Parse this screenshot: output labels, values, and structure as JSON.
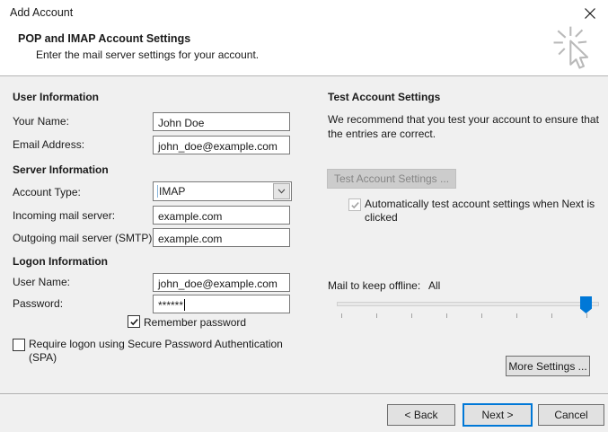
{
  "window": {
    "title": "Add Account",
    "close_icon": "close-icon"
  },
  "header": {
    "title": "POP and IMAP Account Settings",
    "subtitle": "Enter the mail server settings for your account."
  },
  "user_info": {
    "heading": "User Information",
    "your_name_label": "Your Name:",
    "your_name_value": "John Doe",
    "email_label": "Email Address:",
    "email_value": "john_doe@example.com"
  },
  "server_info": {
    "heading": "Server Information",
    "account_type_label": "Account Type:",
    "account_type_value": "IMAP",
    "incoming_label": "Incoming mail server:",
    "incoming_value": "example.com",
    "outgoing_label": "Outgoing mail server (SMTP):",
    "outgoing_value": "example.com"
  },
  "logon_info": {
    "heading": "Logon Information",
    "user_name_label": "User Name:",
    "user_name_value": "john_doe@example.com",
    "password_label": "Password:",
    "password_value": "******",
    "remember_password_label": "Remember password",
    "remember_password_checked": true
  },
  "spa": {
    "label": "Require logon using Secure Password Authentication (SPA)",
    "checked": false
  },
  "test_settings": {
    "heading": "Test Account Settings",
    "description": "We recommend that you test your account to ensure that the entries are correct.",
    "test_button_label": "Test Account Settings ...",
    "test_button_enabled": false,
    "auto_test_label": "Automatically test account settings when Next is clicked",
    "auto_test_checked": true,
    "auto_test_enabled": false
  },
  "offline": {
    "label": "Mail to keep offline:",
    "value": "All",
    "slider_position": "max",
    "tick_count": 8
  },
  "more_settings_label": "More Settings ...",
  "footer": {
    "back_label": "< Back",
    "next_label": "Next >",
    "cancel_label": "Cancel",
    "default_button": "Next >"
  },
  "colors": {
    "accent": "#0078d7",
    "body_bg": "#f0f0f0",
    "header_bg": "#ffffff",
    "disabled_button_bg": "#cccccc",
    "disabled_text": "#868686"
  }
}
